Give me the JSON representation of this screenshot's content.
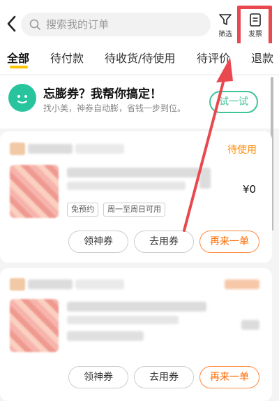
{
  "header": {
    "search_placeholder": "搜索我的订单",
    "filter_label": "筛选",
    "invoice_label": "发票"
  },
  "tabs": [
    {
      "label": "全部",
      "active": true
    },
    {
      "label": "待付款"
    },
    {
      "label": "待收货/待使用"
    },
    {
      "label": "待评价"
    },
    {
      "label": "退款"
    }
  ],
  "promo": {
    "title": "忘膨券？我帮你搞定！",
    "subtitle": "找小美，神券自动膨，省钱一步到位。",
    "button": "试一试"
  },
  "orders": [
    {
      "status": "待使用",
      "price": "¥0",
      "tags": [
        "免预约",
        "周一至周日可用"
      ],
      "buttons": [
        "领神券",
        "去用券",
        "再来一单"
      ]
    },
    {
      "status": "",
      "price": "",
      "tags": [],
      "buttons": [
        "领神券",
        "去用券",
        "再来一单"
      ]
    }
  ],
  "colors": {
    "accent_yellow": "#ffc300",
    "status_orange": "#ff8a00",
    "promo_green": "#3fc39a",
    "annotation_red": "#e8484e"
  }
}
